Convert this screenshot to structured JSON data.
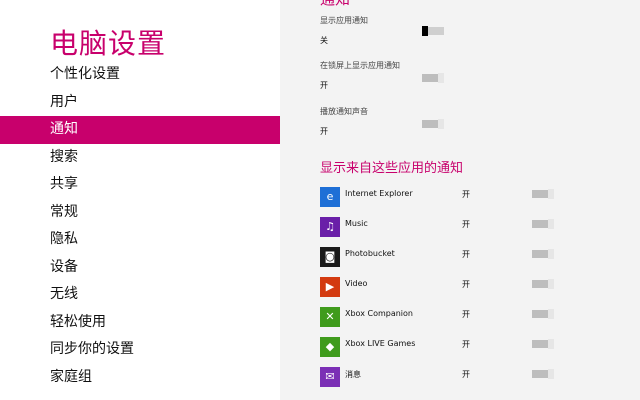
{
  "sidebar": {
    "title": "电脑设置",
    "items": [
      {
        "label": "个性化设置"
      },
      {
        "label": "用户"
      },
      {
        "label": "通知"
      },
      {
        "label": "搜索"
      },
      {
        "label": "共享"
      },
      {
        "label": "常规"
      },
      {
        "label": "隐私"
      },
      {
        "label": "设备"
      },
      {
        "label": "无线"
      },
      {
        "label": "轻松使用"
      },
      {
        "label": "同步你的设置"
      },
      {
        "label": "家庭组"
      }
    ],
    "active_index": 2
  },
  "main": {
    "section_title_top": "通知",
    "settings": [
      {
        "label": "显示应用通知",
        "state": "关",
        "on": false
      },
      {
        "label": "在锁屏上显示应用通知",
        "state": "开",
        "on": true
      },
      {
        "label": "播放通知声音",
        "state": "开",
        "on": true
      }
    ],
    "apps_title": "显示来自这些应用的通知",
    "apps": [
      {
        "name": "Internet Explorer",
        "state": "开",
        "icon": "internet-explorer-icon",
        "color": "#1e6fd6",
        "glyph": "e"
      },
      {
        "name": "Music",
        "state": "开",
        "icon": "headphones-icon",
        "color": "#6a1fa8",
        "glyph": "♫"
      },
      {
        "name": "Photobucket",
        "state": "开",
        "icon": "camera-icon",
        "color": "#1a1a1a",
        "glyph": "◙"
      },
      {
        "name": "Video",
        "state": "开",
        "icon": "play-icon",
        "color": "#d33a10",
        "glyph": "▶"
      },
      {
        "name": "Xbox Companion",
        "state": "开",
        "icon": "xbox-icon",
        "color": "#3f9b1c",
        "glyph": "✕"
      },
      {
        "name": "Xbox LIVE Games",
        "state": "开",
        "icon": "gamepad-icon",
        "color": "#3f9b1c",
        "glyph": "◆"
      },
      {
        "name": "消息",
        "state": "开",
        "icon": "messaging-icon",
        "color": "#7b2fb5",
        "glyph": "✉"
      }
    ]
  }
}
